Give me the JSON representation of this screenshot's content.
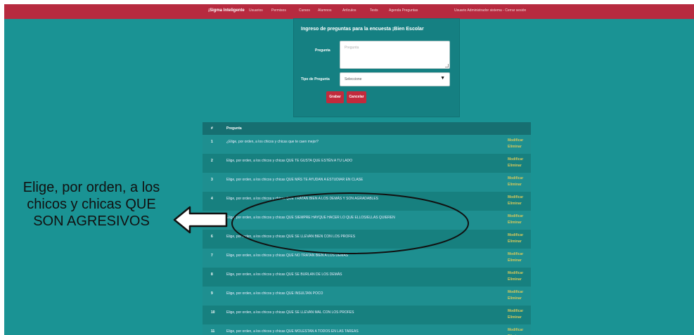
{
  "topbar": {
    "brand": "¡Sigma Inteligente",
    "nav": [
      "Usuarios",
      "Permisos",
      "Cursos",
      "Alumnos",
      "Artículos",
      "Tests",
      "Agenda Preguntas"
    ],
    "user": "Usuario Administrador sistema - Cerrar sesión",
    "color": "#b72a3f"
  },
  "form": {
    "title": "Ingreso de preguntas para la encuesta ¡Bien Escolar",
    "question_label": "Pregunta",
    "question_placeholder": "Pregunta",
    "type_label": "Tipo de Pregunta",
    "type_value": "Seleccione",
    "save_label": "Grabar",
    "cancel_label": "Cancelar"
  },
  "table": {
    "headers": [
      "#",
      "Pregunta"
    ],
    "edit_label": "Modificar",
    "delete_label": "Eliminar",
    "rows": [
      {
        "n": "1",
        "q": "¿Elige, por orden, a los chicos y chicas que te caen mejor?"
      },
      {
        "n": "2",
        "q": "Elige, por orden, a los chicos y chicas QUE TE GUSTA QUE ESTÉN A TU LADO"
      },
      {
        "n": "3",
        "q": "Elige, por orden, a los chicos y chicas QUE MÁS TE AYUDAN A ESTUDIAR EN CLASE"
      },
      {
        "n": "4",
        "q": "Elige, por orden, a los chicos y chicas QUE TRATAN BIEN A LOS DEMÁS Y SON AGRADABLES"
      },
      {
        "n": "5",
        "q": "Elige, por orden, a los chicos y chicas QUE SIEMPRE HAYQUE HACER LO QUE ELLOS/ELLAS QUIEREN"
      },
      {
        "n": "6",
        "q": "Elige, por orden, a los chicos y chicas QUE SE LLEVAN BIEN CON LOS PROFES"
      },
      {
        "n": "7",
        "q": "Elige, por orden, a los chicos y chicas QUE NO TRATAN BIEN A LOS DEMÁS"
      },
      {
        "n": "8",
        "q": "Elige, por orden, a los chicos y chicas QUE SE BURLAN DE LOS DEMÁS"
      },
      {
        "n": "9",
        "q": "Elige, por orden, a los chicos y chicas QUE INSULTAN POCO"
      },
      {
        "n": "10",
        "q": "Elige, por orden, a los chicos y chicas QUE SE LLEVAN MAL CON LOS PROFES"
      },
      {
        "n": "11",
        "q": "Elige, por orden, a los chicos y chicas QUE MOLESTAN A TODOS EN LAS TAREAS"
      }
    ]
  },
  "annotation": {
    "line1": "Elige, por orden, a los",
    "line2": "chicos y chicas QUE",
    "line3": "SON AGRESIVOS"
  }
}
